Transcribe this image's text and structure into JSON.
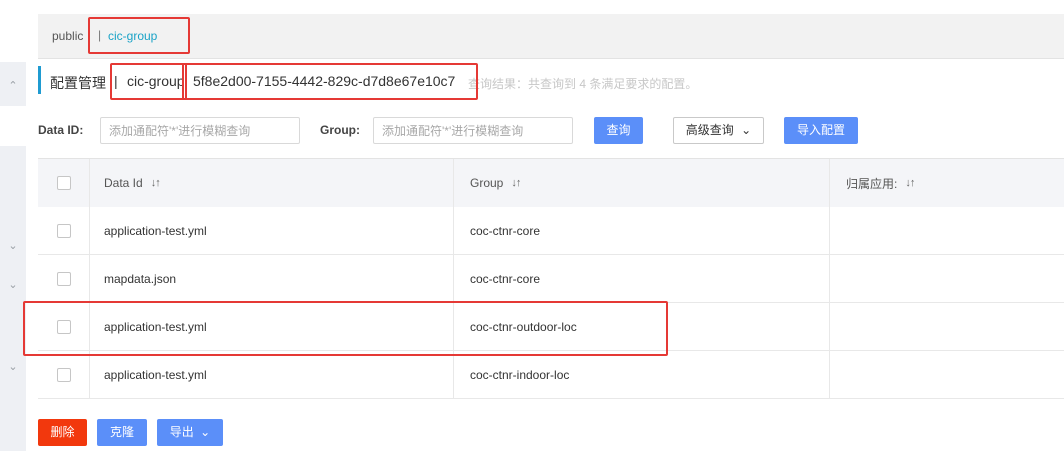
{
  "namespace_bar": {
    "public_label": "public",
    "separator": "|",
    "current_label": "cic-group"
  },
  "title": {
    "main": "配置管理",
    "separator": "|",
    "group": "cic-group",
    "namespace_id": "5f8e2d00-7155-4442-829c-d7d8e67e10c7",
    "result": "查询结果：共查询到 4 条满足要求的配置。"
  },
  "filter": {
    "data_id_label": "Data ID:",
    "data_id_placeholder": "添加通配符'*'进行模糊查询",
    "group_label": "Group:",
    "group_placeholder": "添加通配符'*'进行模糊查询",
    "query_button": "查询",
    "advanced_button": "高级查询",
    "import_button": "导入配置"
  },
  "table": {
    "headers": {
      "data_id": "Data Id",
      "group": "Group",
      "app": "归属应用:"
    },
    "rows": [
      {
        "data_id": "application-test.yml",
        "group": "coc-ctnr-core",
        "app": ""
      },
      {
        "data_id": "mapdata.json",
        "group": "coc-ctnr-core",
        "app": ""
      },
      {
        "data_id": "application-test.yml",
        "group": "coc-ctnr-outdoor-loc",
        "app": ""
      },
      {
        "data_id": "application-test.yml",
        "group": "coc-ctnr-indoor-loc",
        "app": ""
      }
    ]
  },
  "actions": {
    "delete_button": "删除",
    "clone_button": "克隆",
    "export_button": "导出"
  },
  "icons": {
    "sort": "sort-icon",
    "chevron": "chevron-down-icon"
  },
  "colors": {
    "primary": "#5b8ff9",
    "danger": "#f2380d",
    "link": "#1aa3c7",
    "highlight": "#e53935"
  }
}
